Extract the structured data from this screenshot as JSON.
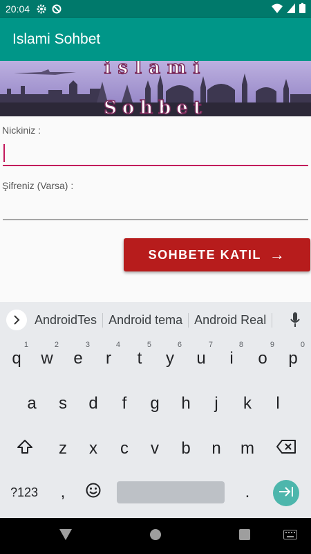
{
  "status_bar": {
    "time": "20:04"
  },
  "app_bar": {
    "title": "Islami Sohbet"
  },
  "banner": {
    "line1": "islami",
    "line2": "Sohbet"
  },
  "form": {
    "nick_label": "Nickiniz :",
    "password_label": "Şifreniz (Varsa) :",
    "join_label": "SOHBETE KATIL",
    "join_arrow": "→"
  },
  "keyboard": {
    "suggestions": [
      "AndroidTes",
      "Android tema",
      "Android Real"
    ],
    "row1": [
      {
        "k": "q",
        "h": "1"
      },
      {
        "k": "w",
        "h": "2"
      },
      {
        "k": "e",
        "h": "3"
      },
      {
        "k": "r",
        "h": "4"
      },
      {
        "k": "t",
        "h": "5"
      },
      {
        "k": "y",
        "h": "6"
      },
      {
        "k": "u",
        "h": "7"
      },
      {
        "k": "i",
        "h": "8"
      },
      {
        "k": "o",
        "h": "9"
      },
      {
        "k": "p",
        "h": "0"
      }
    ],
    "row2": [
      "a",
      "s",
      "d",
      "f",
      "g",
      "h",
      "j",
      "k",
      "l"
    ],
    "row3": [
      "z",
      "x",
      "c",
      "v",
      "b",
      "n",
      "m"
    ],
    "sym_label": "?123",
    "comma": ",",
    "period": "."
  },
  "colors": {
    "status": "#00796b",
    "appbar": "#009688",
    "button": "#b71c1c",
    "accent": "#c2185b"
  }
}
